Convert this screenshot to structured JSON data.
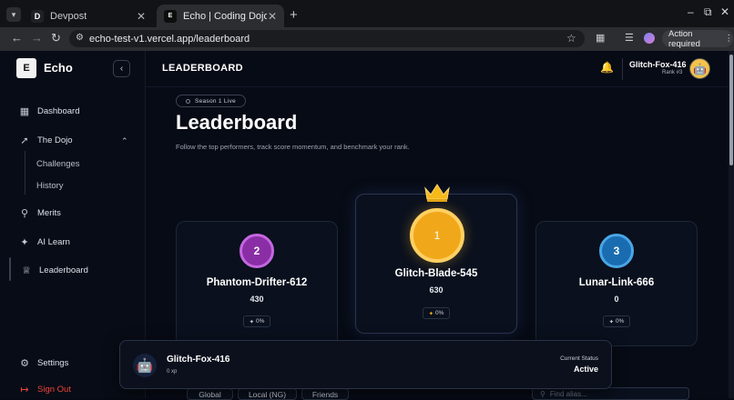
{
  "browser": {
    "tabs": [
      {
        "favicon": "D",
        "title": "Devpost"
      },
      {
        "favicon": "E",
        "title": "Echo | Coding Dojo and C"
      }
    ],
    "url": "echo-test-v1.vercel.app/leaderboard",
    "action_label": "Action required"
  },
  "sidebar": {
    "brand": "Echo",
    "logo_letter": "E",
    "items": [
      {
        "label": "Dashboard",
        "icon": "grid-icon"
      },
      {
        "label": "The Dojo",
        "icon": "sword-icon"
      },
      {
        "label": "Merits",
        "icon": "medal-icon"
      },
      {
        "label": "AI Learn",
        "icon": "sparkles-icon"
      },
      {
        "label": "Leaderboard",
        "icon": "trophy-icon"
      }
    ],
    "dojo_sub": [
      "Challenges",
      "History"
    ],
    "settings": "Settings",
    "signout": "Sign Out"
  },
  "topbar": {
    "title": "LEADERBOARD",
    "user_name": "Glitch-Fox-416",
    "user_rank": "Rank #3"
  },
  "hero": {
    "season": "Season 1 Live",
    "heading": "Leaderboard",
    "subtitle": "Follow the top performers, track score momentum, and benchmark your rank."
  },
  "podium": [
    {
      "rank": "2",
      "name": "Phantom-Drifter-612",
      "score": "430",
      "change": "0%"
    },
    {
      "rank": "1",
      "name": "Glitch-Blade-545",
      "score": "630",
      "change": "0%"
    },
    {
      "rank": "3",
      "name": "Lunar-Link-666",
      "score": "0",
      "change": "0%"
    }
  ],
  "me": {
    "name": "Glitch-Fox-416",
    "xp": "0 xp",
    "status_label": "Current Status",
    "status_value": "Active"
  },
  "filters": [
    "Global",
    "Local (NG)",
    "Friends"
  ],
  "search": {
    "placeholder": "Find alias..."
  },
  "colors": {
    "accent_gold": "#f0a81a",
    "silver_purple": "#8a2ea6",
    "bronze_blue": "#1a6cb0",
    "signout_red": "#f0443a"
  }
}
